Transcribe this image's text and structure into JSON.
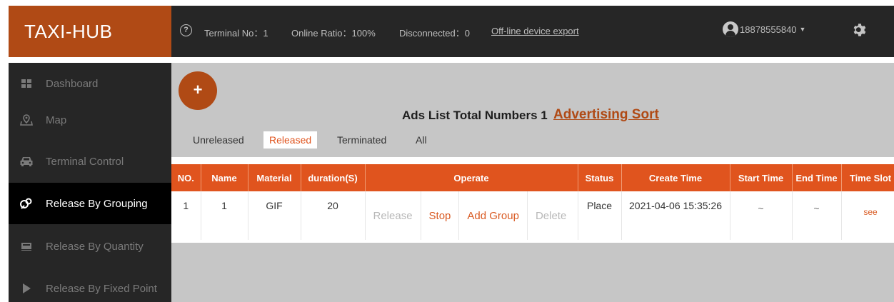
{
  "brand": "TAXI-HUB",
  "header": {
    "terminal_no": "Terminal No：1",
    "online_ratio": "Online Ratio：100%",
    "disconnected": "Disconnected：0",
    "export_link": "Off-line device export",
    "user": "18878555840"
  },
  "sidebar": {
    "items": [
      {
        "label": "Dashboard",
        "icon": "dashboard-icon"
      },
      {
        "label": "Map",
        "icon": "map-icon"
      },
      {
        "label": "Terminal Control",
        "icon": "car-icon"
      },
      {
        "label": "Release By Grouping",
        "icon": "grouping-icon",
        "active": true
      },
      {
        "label": "Release By Quantity",
        "icon": "quantity-icon"
      },
      {
        "label": "Release By Fixed Point",
        "icon": "play-icon"
      }
    ]
  },
  "main": {
    "add_symbol": "+",
    "ads_title": "Ads List Total Numbers 1",
    "ads_sort": "Advertising Sort",
    "tabs": [
      "Unreleased",
      "Released",
      "Terminated",
      "All"
    ],
    "active_tab": "Released",
    "table": {
      "headers": [
        "NO.",
        "Name",
        "Material",
        "duration(S)",
        "Operate",
        "Status",
        "Create Time",
        "Start Time",
        "End Time",
        "Time Slot"
      ],
      "rows": [
        {
          "no": "1",
          "name": "1",
          "material": "GIF",
          "duration": "20",
          "operate": [
            "Release",
            "Stop",
            "Add Group",
            "Delete"
          ],
          "status": "Place",
          "create_time": "2021-04-06 15:35:26",
          "start_time": "~",
          "end_time": "~",
          "time_slot": "see"
        }
      ]
    }
  },
  "colors": {
    "accent": "#e0541e",
    "brand": "#b04a15",
    "topbar": "#262626",
    "sidebar": "#262626",
    "content_bg": "#c6c6c6"
  }
}
